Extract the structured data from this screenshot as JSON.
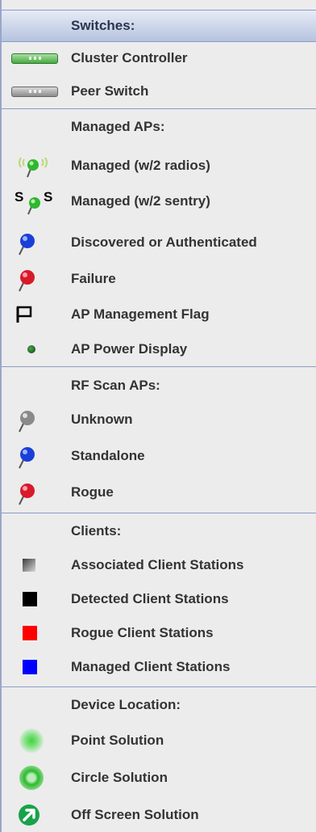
{
  "sections": [
    {
      "header": "Switches:",
      "items": [
        {
          "label": "Cluster Controller",
          "icon": "cluster-controller-switch-icon"
        },
        {
          "label": "Peer Switch",
          "icon": "peer-switch-icon"
        }
      ]
    },
    {
      "header": "Managed APs:",
      "items": [
        {
          "label": "Managed (w/2 radios)",
          "icon": "ap-two-radios-icon"
        },
        {
          "label": "Managed (w/2 sentry)",
          "icon": "ap-two-sentry-icon"
        },
        {
          "label": "Discovered or Authenticated",
          "icon": "blue-pin-icon"
        },
        {
          "label": "Failure",
          "icon": "red-pin-icon"
        },
        {
          "label": "AP Management Flag",
          "icon": "flag-icon"
        },
        {
          "label": "AP Power Display",
          "icon": "power-dot-icon"
        }
      ]
    },
    {
      "header": "RF Scan APs:",
      "items": [
        {
          "label": "Unknown",
          "icon": "gray-pin-icon"
        },
        {
          "label": "Standalone",
          "icon": "blue-pin-icon"
        },
        {
          "label": "Rogue",
          "icon": "red-pin-icon"
        }
      ]
    },
    {
      "header": "Clients:",
      "items": [
        {
          "label": "Associated Client Stations",
          "icon": "gray-square-icon"
        },
        {
          "label": "Detected Client Stations",
          "icon": "black-square-icon"
        },
        {
          "label": "Rogue Client Stations",
          "icon": "red-square-icon"
        },
        {
          "label": "Managed Client Stations",
          "icon": "blue-square-icon"
        }
      ]
    },
    {
      "header": "Device Location:",
      "items": [
        {
          "label": "Point Solution",
          "icon": "point-solution-icon"
        },
        {
          "label": "Circle Solution",
          "icon": "circle-solution-icon"
        },
        {
          "label": "Off Screen Solution",
          "icon": "off-screen-arrow-icon"
        }
      ]
    }
  ],
  "sentry_letter": "S",
  "colors": {
    "green": "#2fb82f",
    "blue": "#1a3fd8",
    "red": "#d81a2a",
    "gray": "#8a8a8a",
    "black": "#000000",
    "square_red": "#ff0000",
    "square_blue": "#0000ff"
  }
}
